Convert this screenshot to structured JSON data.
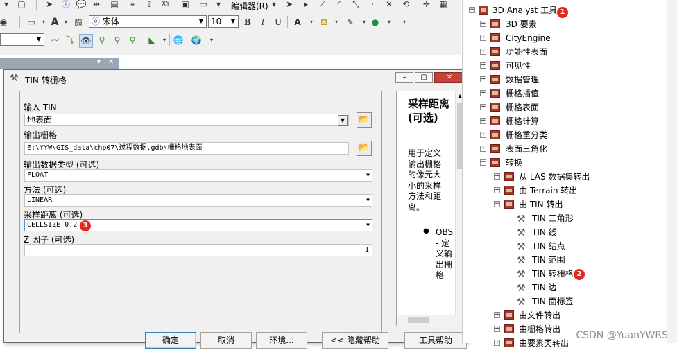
{
  "toolbar": {
    "editor_label": "编辑器(R)",
    "font_name": "宋体",
    "font_size": "10",
    "bold": "B",
    "italic": "I",
    "underline": "U",
    "font_color": "A"
  },
  "embedded_panel": {
    "close": "✕",
    "pin": "▾"
  },
  "dialog": {
    "title": "TIN 转栅格",
    "buttons": {
      "ok": "确定",
      "cancel": "取消",
      "env": "环境...",
      "hide_help": "<< 隐藏帮助",
      "tool_help": "工具帮助"
    },
    "params": {
      "input_tin_label": "输入 TIN",
      "input_tin_value": "地表面",
      "output_raster_label": "输出栅格",
      "output_raster_value": "E:\\YYW\\GIS_data\\chp07\\过程数据.gdb\\栅格地表面",
      "data_type_label": "输出数据类型 (可选)",
      "data_type_value": "FLOAT",
      "method_label": "方法 (可选)",
      "method_value": "LINEAR",
      "sampling_label": "采样距离 (可选)",
      "sampling_value": "CELLSIZE 0.2",
      "z_factor_label": "Z 因子 (可选)",
      "z_factor_value": "1"
    },
    "help": {
      "title": "采样距离 (可选)",
      "text": "用于定义输出栅格的像元大小的采样方法和距离。",
      "bullet": "OBS - 定义输出栅格"
    }
  },
  "annotations": {
    "badge1": "1",
    "badge2": "2",
    "badge3": "3"
  },
  "tree": {
    "root": "3D Analyst 工具",
    "items": [
      {
        "label": "3D 要素"
      },
      {
        "label": "CityEngine"
      },
      {
        "label": "功能性表面"
      },
      {
        "label": "可见性"
      },
      {
        "label": "数据管理"
      },
      {
        "label": "栅格插值"
      },
      {
        "label": "栅格表面"
      },
      {
        "label": "栅格计算"
      },
      {
        "label": "栅格重分类"
      },
      {
        "label": "表面三角化"
      },
      {
        "label": "转换"
      }
    ],
    "conversion": [
      {
        "label": "从 LAS 数据集转出"
      },
      {
        "label": "由 Terrain 转出"
      },
      {
        "label": "由 TIN 转出"
      }
    ],
    "tin_tools": [
      {
        "label": "TIN 三角形"
      },
      {
        "label": "TIN 线"
      },
      {
        "label": "TIN 结点"
      },
      {
        "label": "TIN 范围"
      },
      {
        "label": "TIN 转栅格"
      },
      {
        "label": "TIN 边"
      },
      {
        "label": "TIN 面标签"
      }
    ],
    "after": [
      {
        "label": "由文件转出"
      },
      {
        "label": "由栅格转出"
      },
      {
        "label": "由要素类转出"
      }
    ]
  },
  "watermark": "CSDN @YuanYWRS"
}
